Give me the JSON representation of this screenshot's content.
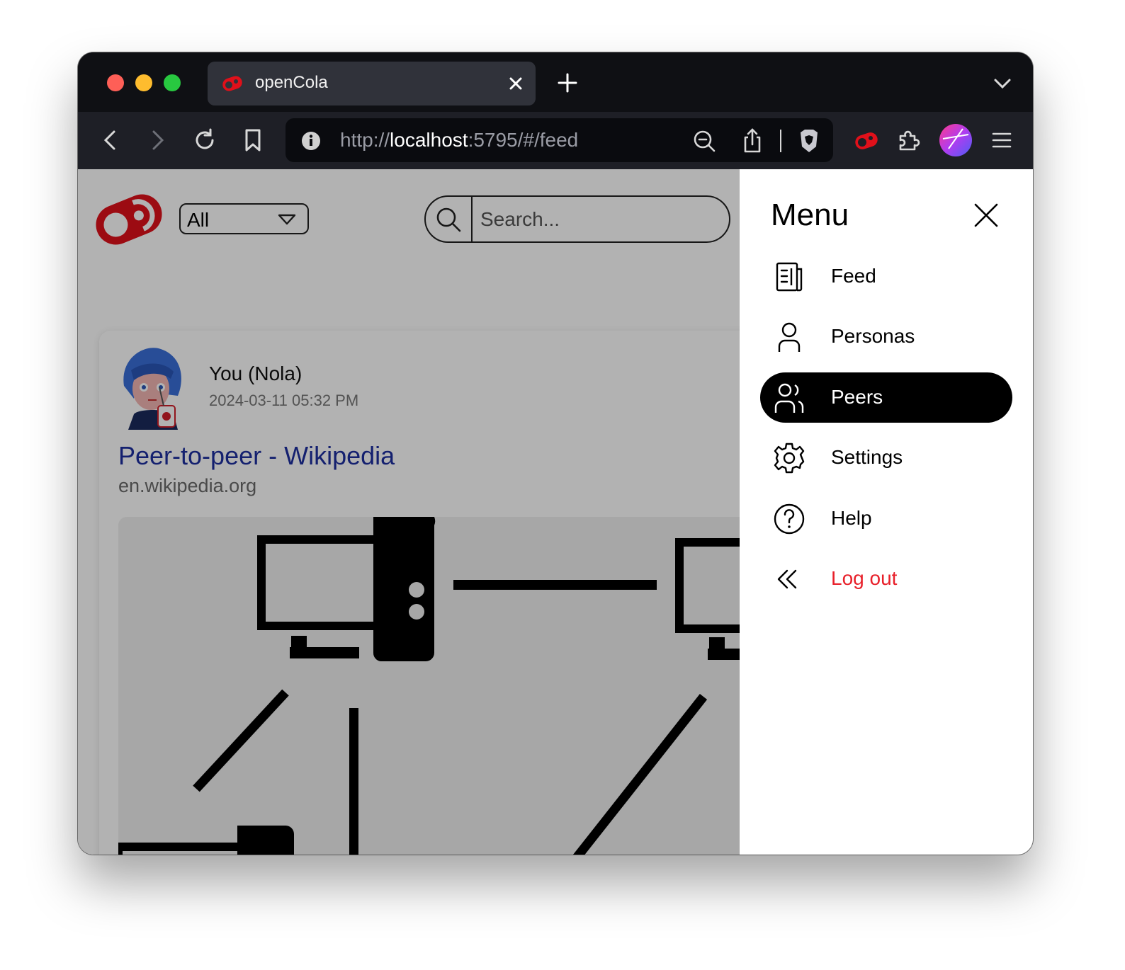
{
  "browser": {
    "tab": {
      "title": "openCola"
    },
    "url": {
      "scheme": "http://",
      "host": "localhost",
      "rest": ":5795/#/feed"
    }
  },
  "app": {
    "filter": {
      "selected": "All"
    },
    "search": {
      "placeholder": "Search..."
    },
    "post": {
      "author": "You (Nola)",
      "date": "2024-03-11 05:32 PM",
      "title": "Peer-to-peer - Wikipedia",
      "domain": "en.wikipedia.org"
    }
  },
  "menu": {
    "title": "Menu",
    "items": [
      {
        "label": "Feed",
        "icon": "feed-icon"
      },
      {
        "label": "Personas",
        "icon": "person-icon"
      },
      {
        "label": "Peers",
        "icon": "peers-icon",
        "active": true
      },
      {
        "label": "Settings",
        "icon": "gear-icon"
      },
      {
        "label": "Help",
        "icon": "help-icon"
      },
      {
        "label": "Log out",
        "icon": "double-chevron-left-icon"
      }
    ]
  },
  "colors": {
    "brand_red": "#e0101a",
    "link_blue": "#1d2fa0",
    "logout_red": "#e8202a",
    "active_item_bg": "#000000"
  }
}
